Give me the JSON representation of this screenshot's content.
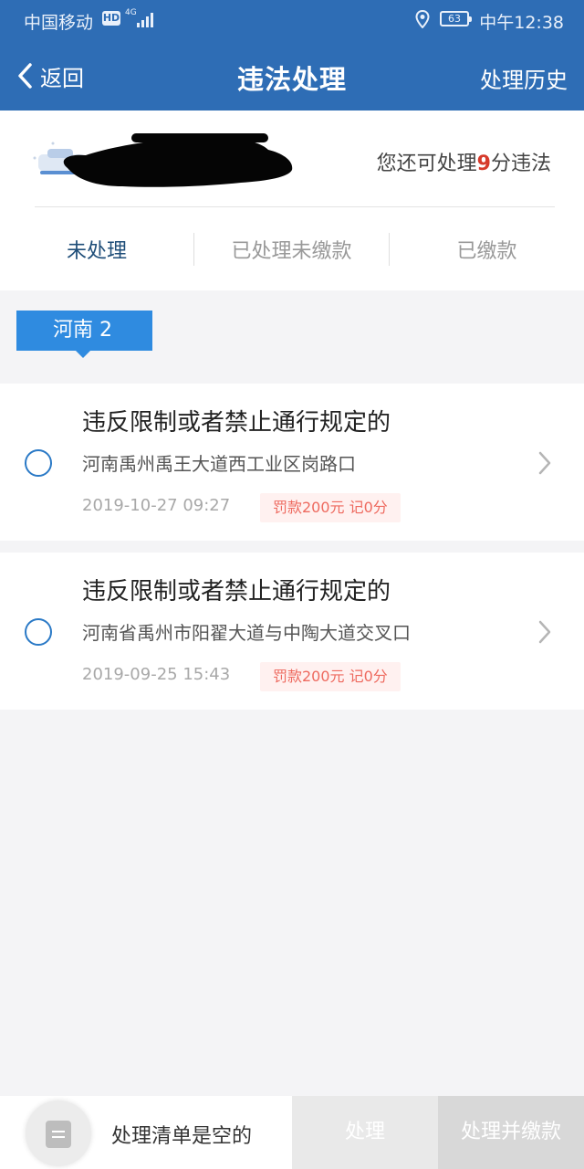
{
  "status_bar": {
    "carrier": "中国移动",
    "hd": "HD",
    "net": "4G",
    "battery": "63",
    "time": "中午12:38"
  },
  "nav": {
    "back_label": "返回",
    "title": "违法处理",
    "history_label": "处理历史"
  },
  "summary": {
    "points_prefix": "您还可处理",
    "points_value": "9",
    "points_suffix": "分违法"
  },
  "tabs": [
    {
      "label": "未处理",
      "active": true
    },
    {
      "label": "已处理未缴款",
      "active": false
    },
    {
      "label": "已缴款",
      "active": false
    }
  ],
  "region_tag": "河南 2",
  "violations": [
    {
      "title": "违反限制或者禁止通行规定的",
      "location": "河南禹州禹王大道西工业区岗路口",
      "time": "2019-10-27 09:27",
      "fine": "罚款200元 记0分"
    },
    {
      "title": "违反限制或者禁止通行规定的",
      "location": "河南省禹州市阳翟大道与中陶大道交叉口",
      "time": "2019-09-25 15:43",
      "fine": "罚款200元 记0分"
    }
  ],
  "bottom": {
    "empty_text": "处理清单是空的",
    "process_label": "处理",
    "pay_label": "处理并缴款"
  },
  "colors": {
    "primary": "#2e6db5",
    "accent_red": "#d63a2b",
    "tag_blue": "#2f8be0"
  }
}
